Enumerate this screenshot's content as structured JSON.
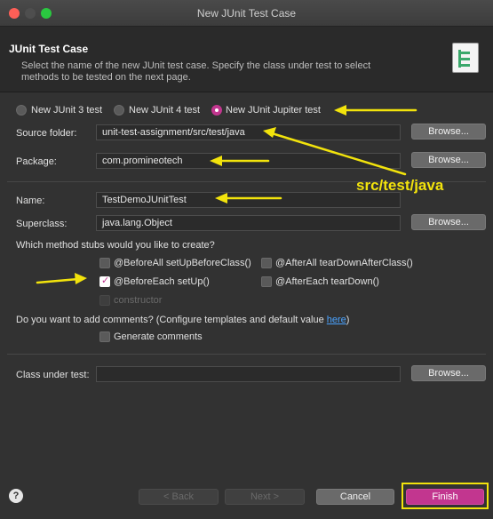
{
  "window": {
    "title": "New JUnit Test Case"
  },
  "header": {
    "title": "JUnit Test Case",
    "description": "Select the name of the new JUnit test case. Specify the class under test to select methods to be tested on the next page."
  },
  "test_type": {
    "options": [
      {
        "label": "New JUnit 3 test",
        "selected": false
      },
      {
        "label": "New JUnit 4 test",
        "selected": false
      },
      {
        "label": "New JUnit Jupiter test",
        "selected": true
      }
    ]
  },
  "form": {
    "source_folder": {
      "label": "Source folder:",
      "value": "unit-test-assignment/src/test/java"
    },
    "package": {
      "label": "Package:",
      "value": "com.promineotech"
    },
    "name": {
      "label": "Name:",
      "value": "TestDemoJUnitTest"
    },
    "superclass": {
      "label": "Superclass:",
      "value": "java.lang.Object"
    },
    "class_under_test": {
      "label": "Class under test:",
      "value": ""
    },
    "browse_label": "Browse..."
  },
  "stubs": {
    "question": "Which method stubs would you like to create?",
    "items": [
      {
        "label": "@BeforeAll setUpBeforeClass()",
        "checked": false
      },
      {
        "label": "@AfterAll tearDownAfterClass()",
        "checked": false
      },
      {
        "label": "@BeforeEach setUp()",
        "checked": true
      },
      {
        "label": "@AfterEach tearDown()",
        "checked": false
      },
      {
        "label": "constructor",
        "checked": false
      }
    ]
  },
  "comments": {
    "question": "Do you want to add comments? (Configure templates and default value ",
    "link": "here",
    "question_end": ")",
    "generate_label": "Generate comments"
  },
  "footer": {
    "back_label": "< Back",
    "next_label": "Next >",
    "cancel_label": "Cancel",
    "finish_label": "Finish"
  },
  "annotation": {
    "text": "src/test/java",
    "color": "#f2e30c"
  },
  "colors": {
    "accent": "#c2368f",
    "background": "#323232",
    "link": "#4aa3ff"
  }
}
